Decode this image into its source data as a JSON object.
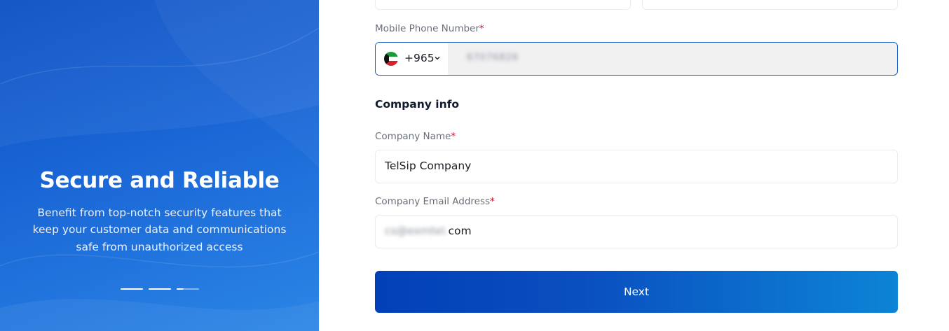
{
  "hero": {
    "title": "Secure and Reliable",
    "description": "Benefit from top-notch security features that keep your customer data and communications safe from unauthorized access",
    "carousel_active_index": 2,
    "carousel_count": 3
  },
  "form": {
    "mobile_phone": {
      "label": "Mobile Phone Number",
      "required_mark": "*",
      "country_code": "+965",
      "country_flag": "kuwait-flag-icon",
      "value": "67076826"
    },
    "company_section_title": "Company info",
    "company_name": {
      "label": "Company Name",
      "required_mark": "*",
      "value": "TelSip Company"
    },
    "company_email": {
      "label": "Company Email Address",
      "required_mark": "*",
      "value_hidden": "cs@exmtel.",
      "value_visible": "com"
    },
    "next_button": "Next"
  },
  "colors": {
    "accent": "#0a4fc4",
    "required": "#c8102e",
    "focus_border": "#1d64c8"
  }
}
